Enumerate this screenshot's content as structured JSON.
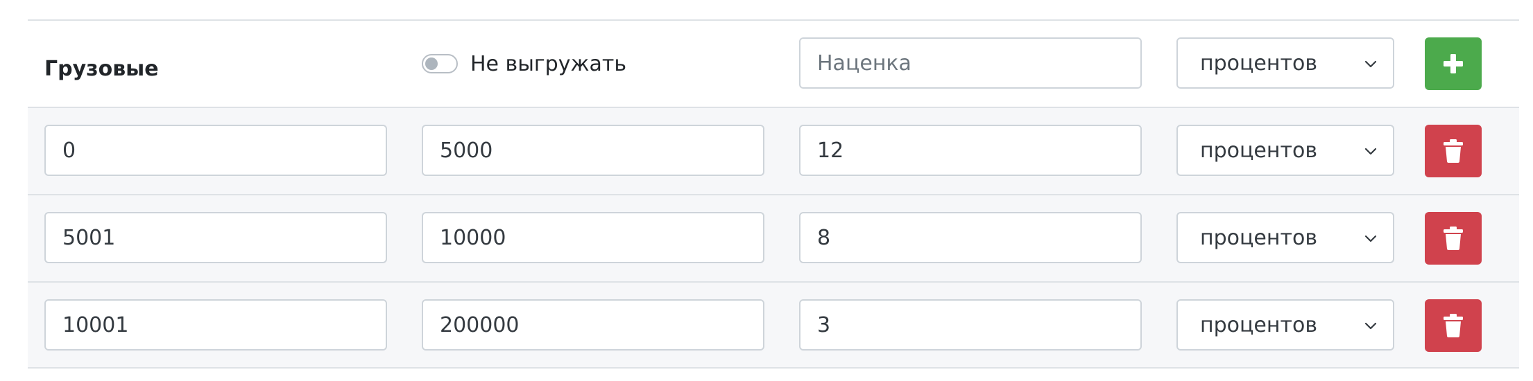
{
  "header": {
    "title": "Грузовые",
    "toggle_label": "Не выгружать",
    "toggle_on": false,
    "markup_placeholder": "Наценка",
    "unit_value": "процентов",
    "add_icon": "plus-icon"
  },
  "rows": [
    {
      "from": "0",
      "to": "5000",
      "markup": "12",
      "unit": "процентов"
    },
    {
      "from": "5001",
      "to": "10000",
      "markup": "8",
      "unit": "процентов"
    },
    {
      "from": "10001",
      "to": "200000",
      "markup": "3",
      "unit": "процентов"
    }
  ],
  "delete_icon": "trash-icon",
  "colors": {
    "add_button": "#4caa4c",
    "delete_button": "#d0424d",
    "row_background": "#f6f7f9",
    "border": "#ced4da"
  }
}
